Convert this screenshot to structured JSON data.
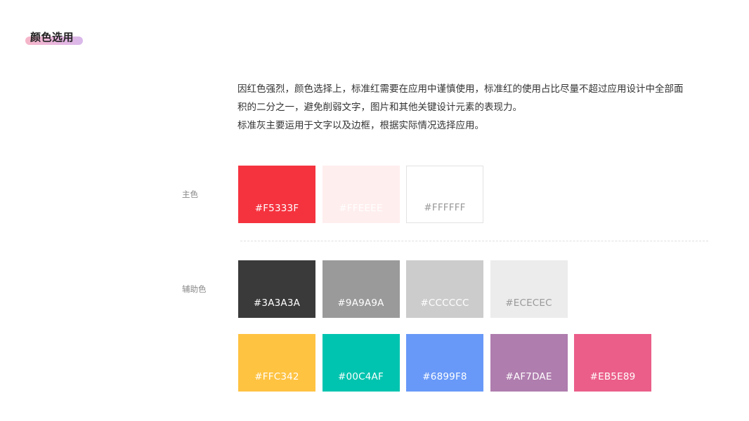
{
  "title": "颜色选用",
  "description": {
    "line1": "因红色强烈，颜色选择上，标准红需要在应用中谨慎使用，标准红的使用占比尽量不超过应用设计中全部面",
    "line2": "积的二分之一，避免削弱文字，图片和其他关键设计元素的表现力。",
    "line3": "标准灰主要运用于文字以及边框，根据实际情况选择应用。"
  },
  "primary": {
    "label": "主色",
    "swatches": [
      {
        "code": "#F5333F",
        "color": "#F5333F",
        "text_color": "#ffffff"
      },
      {
        "code": "#FFEEEE",
        "color": "#FFEEEE",
        "text_color": "#ffffff"
      },
      {
        "code": "#FFFFFF",
        "color": "#FFFFFF",
        "text_color": "#999999"
      }
    ]
  },
  "secondary": {
    "label": "辅助色",
    "grays": [
      {
        "code": "#3A3A3A",
        "color": "#3A3A3A",
        "text_color": "#ffffff"
      },
      {
        "code": "#9A9A9A",
        "color": "#9A9A9A",
        "text_color": "#ffffff"
      },
      {
        "code": "#CCCCCC",
        "color": "#CCCCCC",
        "text_color": "#ffffff"
      },
      {
        "code": "#ECECEC",
        "color": "#ECECEC",
        "text_color": "#999999"
      }
    ],
    "accents": [
      {
        "code": "#FFC342",
        "color": "#FFC342",
        "text_color": "#ffffff"
      },
      {
        "code": "#00C4AF",
        "color": "#00C4AF",
        "text_color": "#ffffff"
      },
      {
        "code": "#6899F8",
        "color": "#6899F8",
        "text_color": "#ffffff"
      },
      {
        "code": "#AF7DAE",
        "color": "#AF7DAE",
        "text_color": "#ffffff"
      },
      {
        "code": "#EB5E89",
        "color": "#EB5E89",
        "text_color": "#ffffff"
      }
    ]
  }
}
